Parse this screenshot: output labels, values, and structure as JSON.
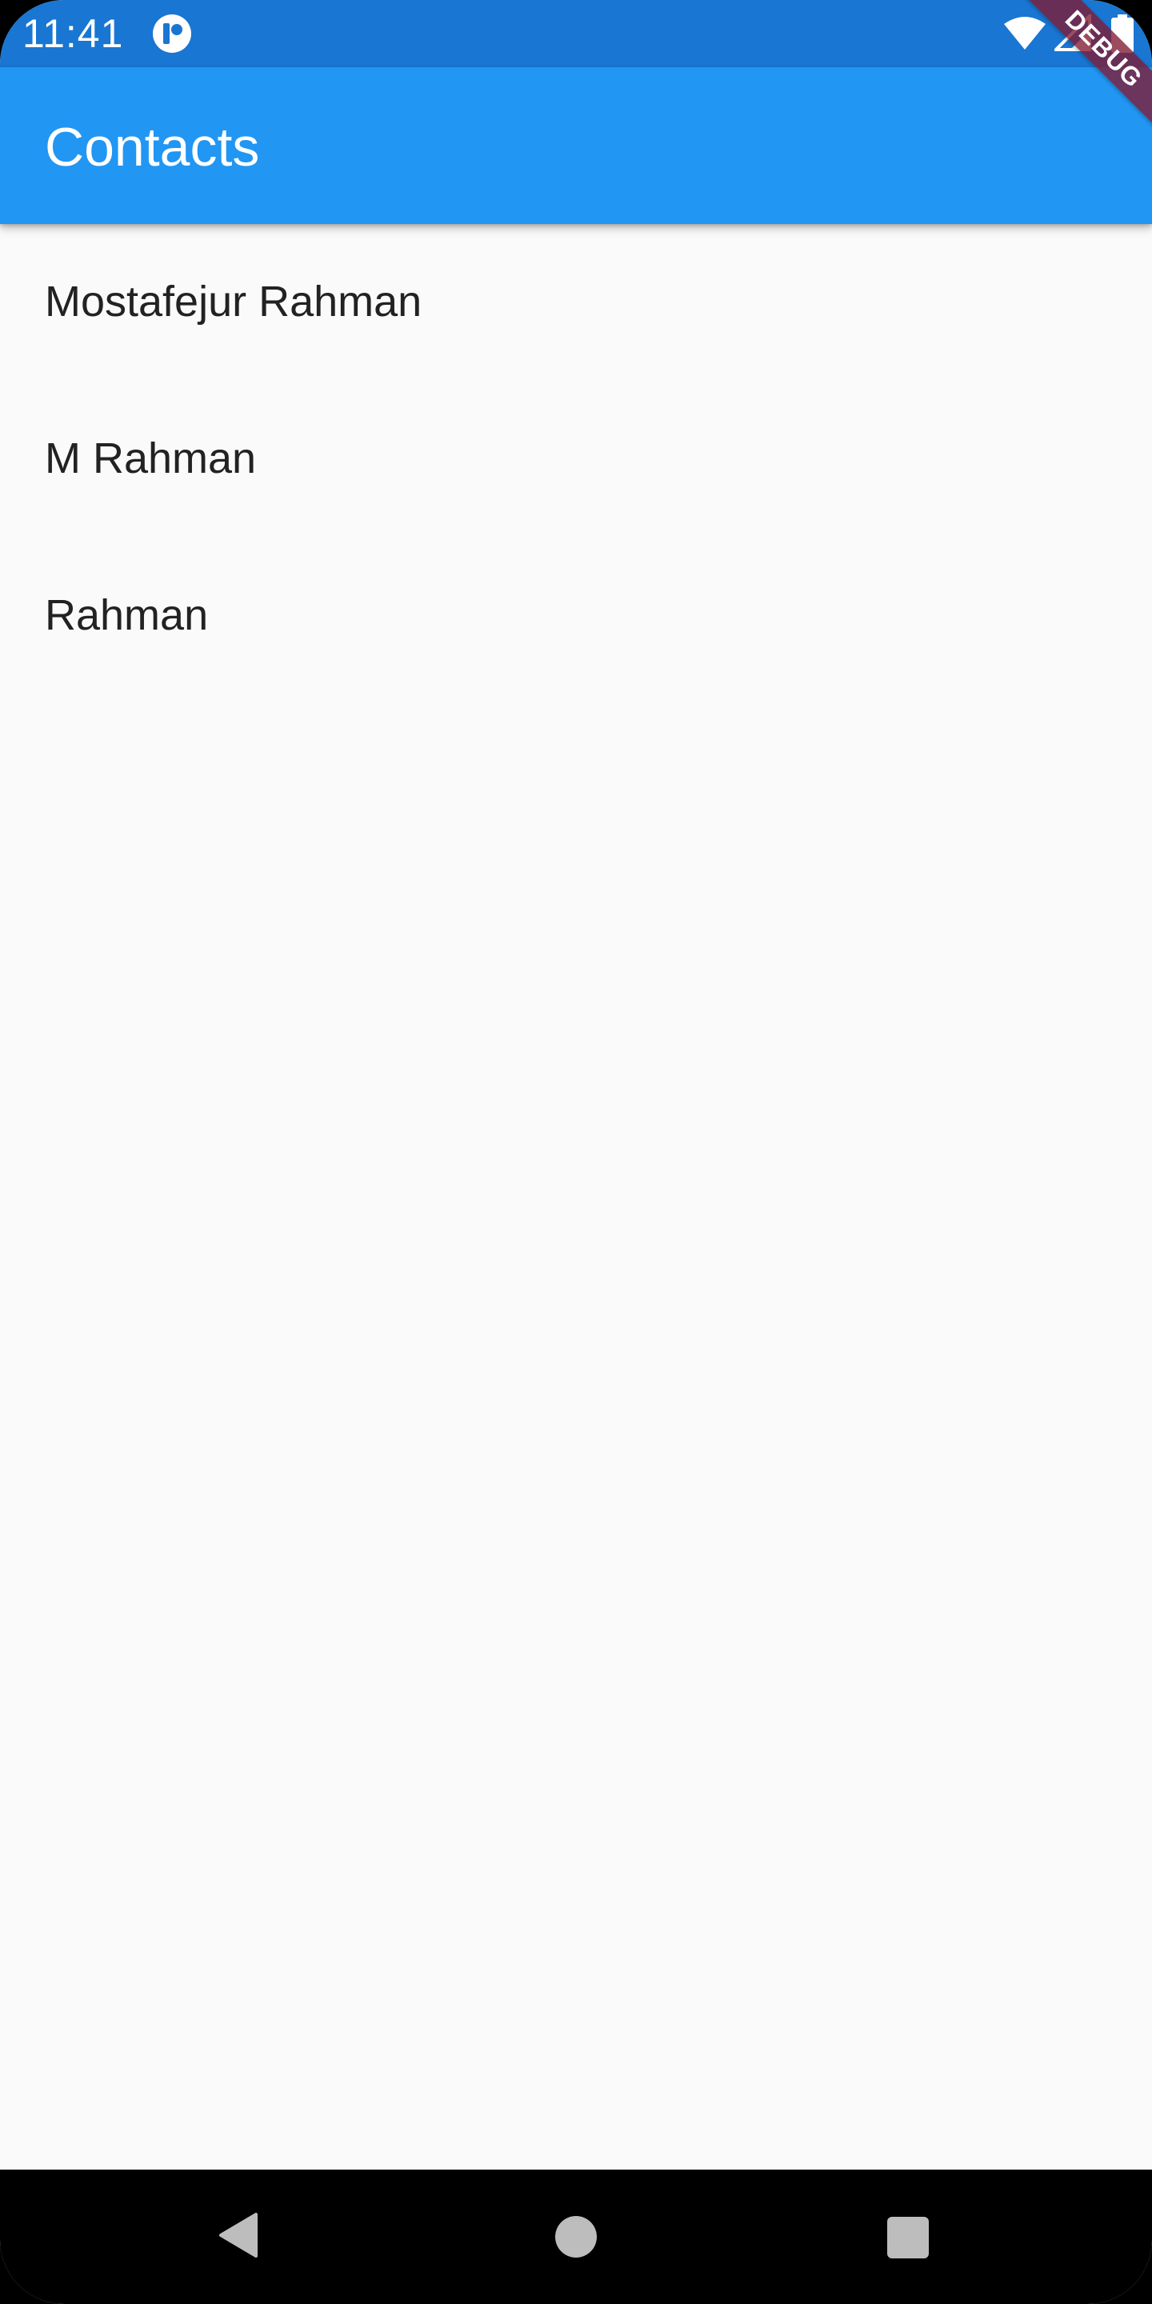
{
  "status_bar": {
    "time": "11:41",
    "icons": [
      "app-notification-icon",
      "wifi-icon",
      "cellular-signal-icon",
      "battery-icon"
    ]
  },
  "debug_banner": {
    "label": "DEBUG"
  },
  "app_bar": {
    "title": "Contacts"
  },
  "contacts": [
    {
      "name": "Mostafejur Rahman"
    },
    {
      "name": "M Rahman"
    },
    {
      "name": "Rahman"
    }
  ],
  "navigation_bar": {
    "buttons": [
      "back-icon",
      "home-icon",
      "recents-icon"
    ]
  },
  "colors": {
    "status_bar": "#1976d2",
    "app_bar": "#2196f3",
    "background": "#fafafa",
    "debug_ribbon": "#801a32",
    "nav_bar": "#000000"
  }
}
